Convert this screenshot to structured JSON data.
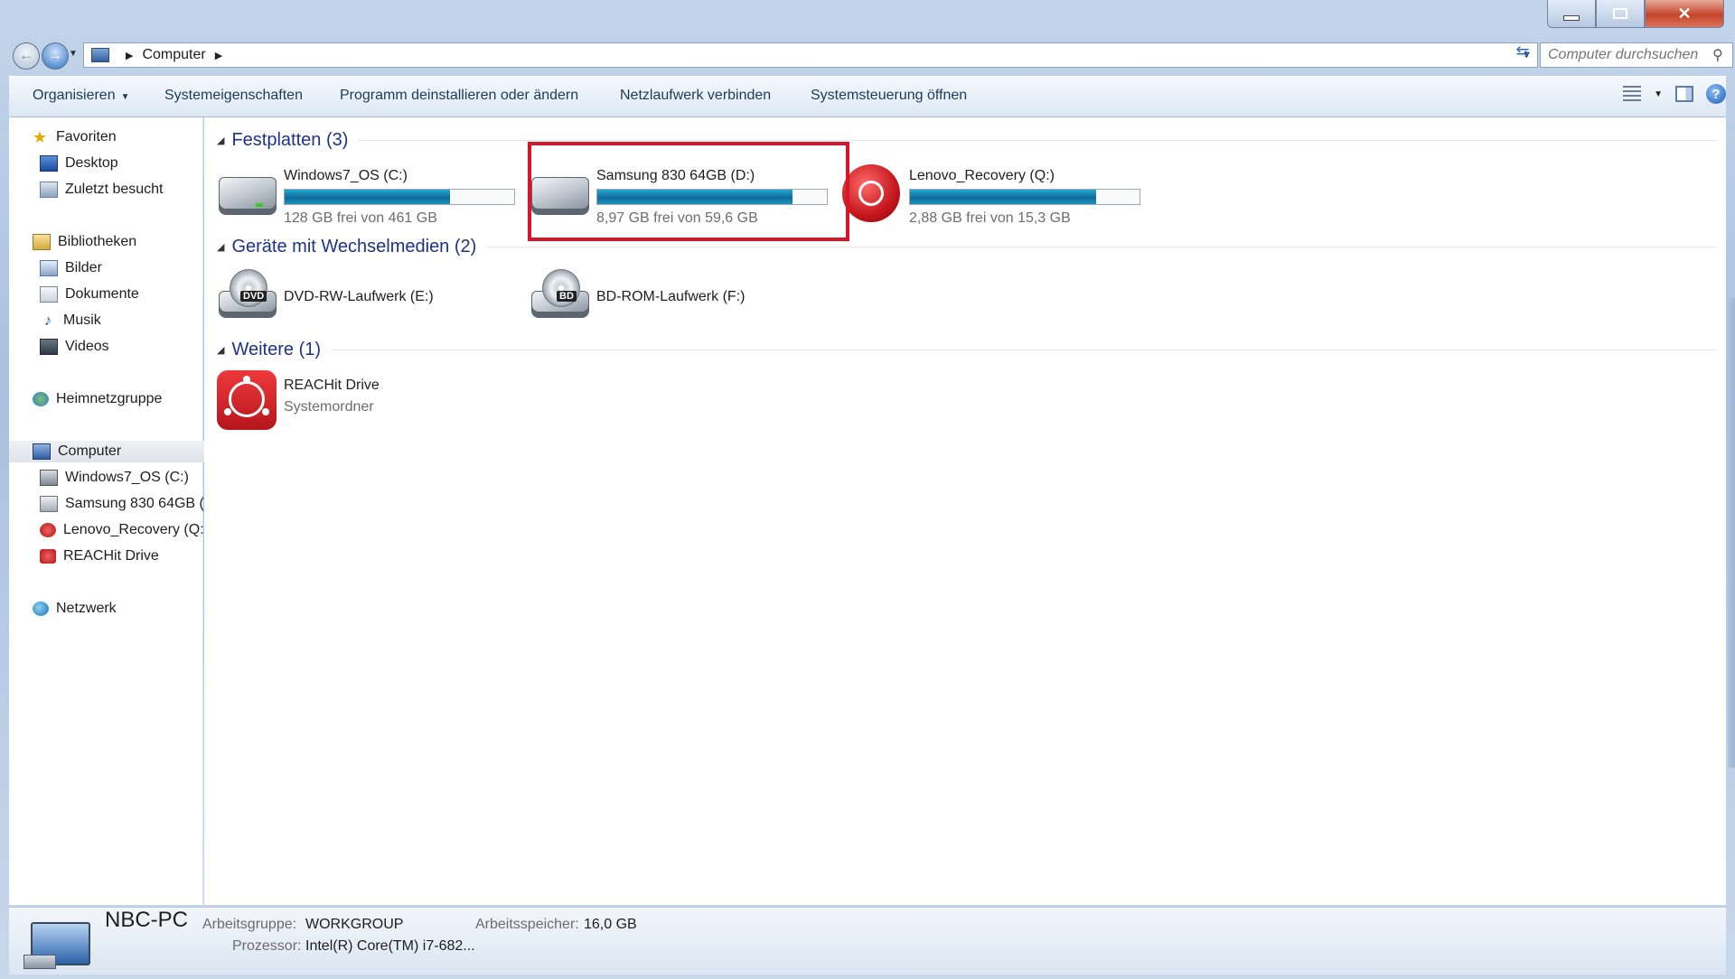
{
  "window": {
    "controls": {
      "minimize": "–",
      "maximize": "□",
      "close": "✕"
    }
  },
  "addressbar": {
    "crumb": "Computer",
    "search_placeholder": "Computer durchsuchen"
  },
  "toolbar": {
    "organize": "Organisieren",
    "system_properties": "Systemeigenschaften",
    "uninstall": "Programm deinstallieren oder ändern",
    "map_drive": "Netzlaufwerk verbinden",
    "control_panel": "Systemsteuerung öffnen",
    "help": "?"
  },
  "navpane": {
    "favorites": "Favoriten",
    "desktop": "Desktop",
    "recent": "Zuletzt besucht",
    "libraries": "Bibliotheken",
    "pictures": "Bilder",
    "documents": "Dokumente",
    "music": "Musik",
    "videos": "Videos",
    "homegroup": "Heimnetzgruppe",
    "computer": "Computer",
    "drive_c": "Windows7_OS (C:)",
    "drive_d": "Samsung 830 64GB (",
    "drive_q": "Lenovo_Recovery (Q:)",
    "reachit": "REACHit Drive",
    "network": "Netzwerk"
  },
  "groups": {
    "hdd": "Festplatten (3)",
    "removable": "Geräte mit Wechselmedien (2)",
    "other": "Weitere (1)"
  },
  "drives": [
    {
      "name": "Windows7_OS (C:)",
      "free": "128 GB frei von 461 GB",
      "used_fraction": 0.72
    },
    {
      "name": "Samsung 830 64GB (D:)",
      "free": "8,97 GB frei von 59,6 GB",
      "used_fraction": 0.85
    },
    {
      "name": "Lenovo_Recovery (Q:)",
      "free": "2,88 GB frei von 15,3 GB",
      "used_fraction": 0.81
    }
  ],
  "removable": [
    {
      "name": "DVD-RW-Laufwerk (E:)",
      "badge": "DVD"
    },
    {
      "name": "BD-ROM-Laufwerk (F:)",
      "badge": "BD"
    }
  ],
  "other": [
    {
      "name": "REACHit Drive",
      "type": "Systemordner"
    }
  ],
  "details": {
    "pc_name": "NBC-PC",
    "workgroup_label": "Arbeitsgruppe:",
    "workgroup": "WORKGROUP",
    "memory_label": "Arbeitsspeicher:",
    "memory": "16,0 GB",
    "processor_label": "Prozessor:",
    "processor": "Intel(R) Core(TM) i7-682..."
  },
  "colors": {
    "highlight": "#d7162a",
    "bar_fill": "#0e6b9a",
    "group_title": "#1e3287"
  }
}
